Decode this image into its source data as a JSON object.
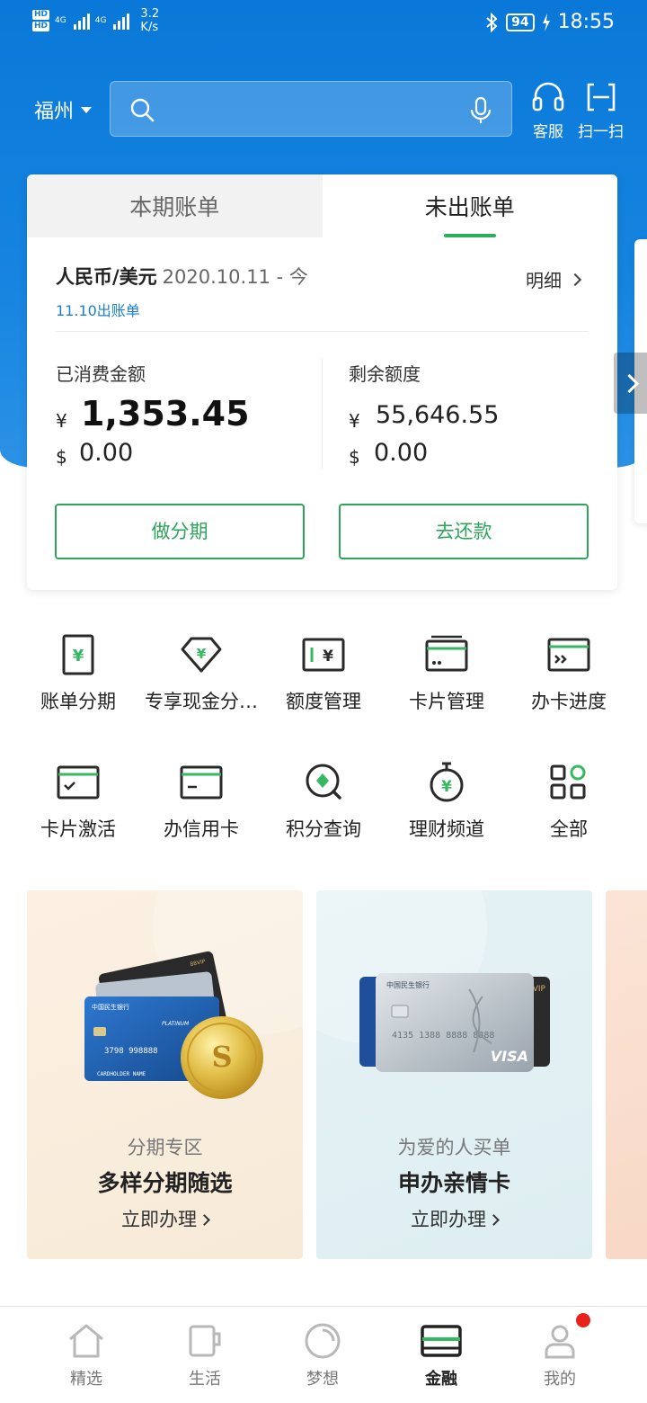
{
  "status_bar": {
    "hd1": "HD",
    "hd2": "HD",
    "net1": "4G",
    "net2": "4G",
    "speed_value": "3.2",
    "speed_unit": "K/s",
    "battery": "94",
    "time": "18:55"
  },
  "header": {
    "city": "福州",
    "search_placeholder": "",
    "service_label": "客服",
    "scan_label": "扫一扫"
  },
  "bill_card": {
    "tabs": [
      {
        "label": "本期账单",
        "active": false
      },
      {
        "label": "未出账单",
        "active": true
      }
    ],
    "currency": "人民币/美元",
    "period": "2020.10.11 - 今",
    "due_text": "11.10出账单",
    "detail_label": "明细",
    "spent_title": "已消费金额",
    "spent_cny": "1,353.45",
    "spent_usd": "0.00",
    "remaining_title": "剩余额度",
    "remaining_cny": "55,646.55",
    "remaining_usd": "0.00",
    "yen_symbol": "¥",
    "dollar_symbol": "$",
    "installment_button": "做分期",
    "repay_button": "去还款"
  },
  "services": [
    {
      "label": "账单分期",
      "icon": "bill-installment-icon"
    },
    {
      "label": "专享现金分…",
      "icon": "cash-installment-icon"
    },
    {
      "label": "额度管理",
      "icon": "credit-limit-icon"
    },
    {
      "label": "卡片管理",
      "icon": "card-manage-icon"
    },
    {
      "label": "办卡进度",
      "icon": "card-progress-icon"
    },
    {
      "label": "卡片激活",
      "icon": "card-activate-icon"
    },
    {
      "label": "办信用卡",
      "icon": "apply-card-icon"
    },
    {
      "label": "积分查询",
      "icon": "points-query-icon"
    },
    {
      "label": "理财频道",
      "icon": "wealth-channel-icon"
    },
    {
      "label": "全部",
      "icon": "all-services-icon"
    }
  ],
  "promos": [
    {
      "subtitle": "分期专区",
      "title": "多样分期随选",
      "cta": "立即办理"
    },
    {
      "subtitle": "为爱的人买单",
      "title": "申办亲情卡",
      "cta": "立即办理"
    }
  ],
  "promo_card_text": {
    "bank_name": "中国民生银行",
    "tier_1": "PLATINUM",
    "number_1": "3798 998888",
    "holder_1": "CARDHOLDER NAME",
    "tier_2": "VIP",
    "brand_2": "VISA"
  },
  "bottom_nav": [
    {
      "label": "精选",
      "active": false
    },
    {
      "label": "生活",
      "active": false
    },
    {
      "label": "梦想",
      "active": false
    },
    {
      "label": "金融",
      "active": true
    },
    {
      "label": "我的",
      "active": false
    }
  ],
  "colors": {
    "brand_blue": "#1780dc",
    "accent_green": "#2ea35a",
    "link_blue": "#1a7fd4",
    "badge_red": "#e8211d"
  }
}
